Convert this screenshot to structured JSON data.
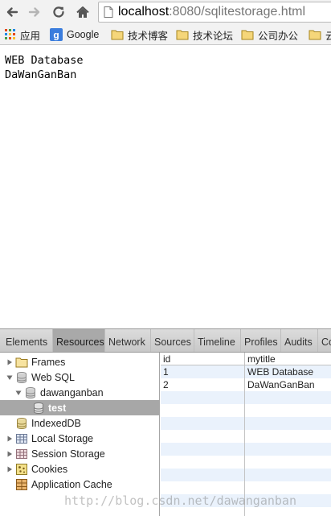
{
  "browser": {
    "url_host": "localhost",
    "url_path": ":8080/sqlitestorage.html",
    "bookmarks": [
      {
        "label": "应用",
        "icon": "apps-grid-icon"
      },
      {
        "label": "Google",
        "icon": "google-icon"
      },
      {
        "label": "技术博客",
        "icon": "folder-icon"
      },
      {
        "label": "技术论坛",
        "icon": "folder-icon"
      },
      {
        "label": "公司办公",
        "icon": "folder-icon"
      },
      {
        "label": "云",
        "icon": "folder-icon"
      }
    ]
  },
  "page": {
    "lines": [
      "WEB Database",
      "DaWanGanBan"
    ]
  },
  "devtools": {
    "tabs": [
      "Elements",
      "Resources",
      "Network",
      "Sources",
      "Timeline",
      "Profiles",
      "Audits",
      "Co"
    ],
    "active_tab": "Resources",
    "tree": {
      "frames": "Frames",
      "web_sql": "Web SQL",
      "database": "dawanganban",
      "table": "test",
      "indexeddb": "IndexedDB",
      "local_storage": "Local Storage",
      "session_storage": "Session Storage",
      "cookies": "Cookies",
      "app_cache": "Application Cache"
    },
    "grid": {
      "columns": [
        "id",
        "mytitle"
      ],
      "rows": [
        [
          "1",
          "WEB Database"
        ],
        [
          "2",
          "DaWanGanBan"
        ]
      ]
    }
  },
  "watermark": "http://blog.csdn.net/dawanganban",
  "colors": {
    "selection_row": "#a7a7a7",
    "grid_alt_row": "#eaf2fc",
    "tab_active": "#a9a9a9"
  }
}
